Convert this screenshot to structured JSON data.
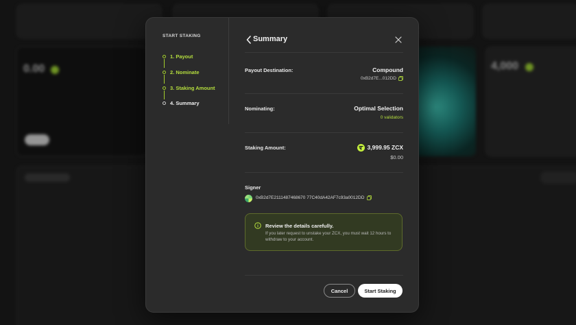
{
  "modal": {
    "steps_title": "START STAKING",
    "steps": [
      {
        "label": "1. Payout",
        "state": "done"
      },
      {
        "label": "2. Nominate",
        "state": "done"
      },
      {
        "label": "3. Staking Amount",
        "state": "done"
      },
      {
        "label": "4. Summary",
        "state": "current"
      }
    ],
    "title": "Summary",
    "payout": {
      "label": "Payout Destination:",
      "value": "Compound",
      "address": "0xB2d7E...012DD"
    },
    "nominating": {
      "label": "Nominating:",
      "value": "Optimal Selection",
      "sub": "0 validators"
    },
    "staking_amount": {
      "label": "Staking Amount:",
      "value": "3,999.95 ZCX",
      "fiat": "$0.00"
    },
    "signer": {
      "label": "Signer",
      "address": "0xB2d7E2111487468670 77C40dA42AF7c93a0012DD"
    },
    "notice": {
      "title": "Review the details carefully.",
      "body": "If you later request to unstake your ZCX, you must wait 12 hours to withdraw to your account."
    },
    "buttons": {
      "cancel": "Cancel",
      "start": "Start Staking"
    }
  },
  "colors": {
    "accent": "#b5de3e",
    "modal_bg": "#2b2b2b",
    "page_bg": "#1b1b1b"
  }
}
